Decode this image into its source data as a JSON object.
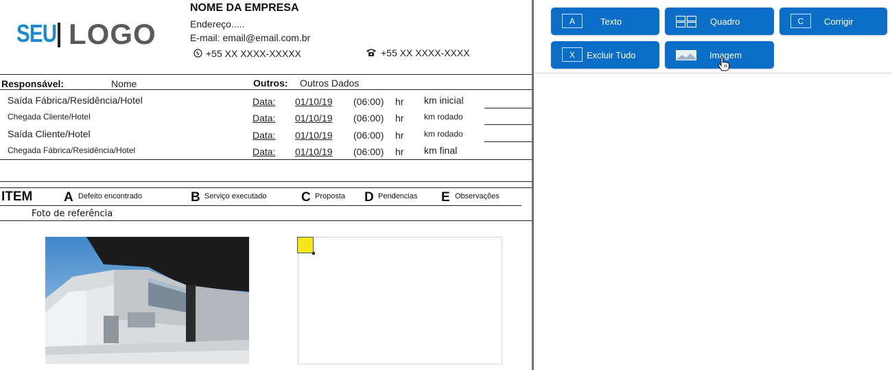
{
  "header": {
    "logo_part1": "SEU",
    "logo_part2": "LOGO",
    "company_name": "NOME DA EMPRESA",
    "address": "Endereço.....",
    "email": "E-mail: email@email.com.br",
    "phone_mobile": "+55 XX XXXX-XXXXX",
    "phone_landline": "+55 XX XXXX-XXXX"
  },
  "info": {
    "responsavel_label": "Responsável:",
    "responsavel_value": "Nome",
    "outros_label": "Outros:",
    "outros_value": "Outros Dados"
  },
  "trips": [
    {
      "label": "Saída Fábrica/Residência/Hotel",
      "data_label": "Data:",
      "date": "01/10/19",
      "time": "(06:00)",
      "hr": "hr",
      "km": "km inicial"
    },
    {
      "label": "Chegada Cliente/Hotel",
      "data_label": "Data:",
      "date": "01/10/19",
      "time": "(06:00)",
      "hr": "hr",
      "km": "km rodado"
    },
    {
      "label": "Saída Cliente/Hotel",
      "data_label": "Data:",
      "date": "01/10/19",
      "time": "(06:00)",
      "hr": "hr",
      "km": "km rodado"
    },
    {
      "label": "Chegada Fábrica/Residência/Hotel",
      "data_label": "Data:",
      "date": "01/10/19",
      "time": "(06:00)",
      "hr": "hr",
      "km": "km final"
    }
  ],
  "items": {
    "title": "ITEM",
    "columns": [
      {
        "letter": "A",
        "text": "Defeito encontrado"
      },
      {
        "letter": "B",
        "text": "Serviço executado"
      },
      {
        "letter": "C",
        "text": "Proposta"
      },
      {
        "letter": "D",
        "text": "Pendencias"
      },
      {
        "letter": "E",
        "text": "Observações"
      }
    ]
  },
  "photo_caption": "Foto de referência",
  "toolbar": {
    "buttons": [
      {
        "key": "A",
        "label": "Texto"
      },
      {
        "key": "",
        "label": "Quadro"
      },
      {
        "key": "C",
        "label": "Corrigir"
      },
      {
        "key": "X",
        "label": "Excluir Tudo"
      },
      {
        "key": "",
        "label": "Imagem"
      }
    ]
  },
  "colors": {
    "button_blue": "#0a6dc7",
    "logo_blue": "#1a8ad4",
    "handle_yellow": "#f5e51a"
  },
  "icons": {
    "mobile": "phone-circle-icon",
    "landline": "telephone-icon",
    "quadro": "grid-icon",
    "imagem": "image-icon",
    "cursor": "hand-cursor-icon"
  }
}
